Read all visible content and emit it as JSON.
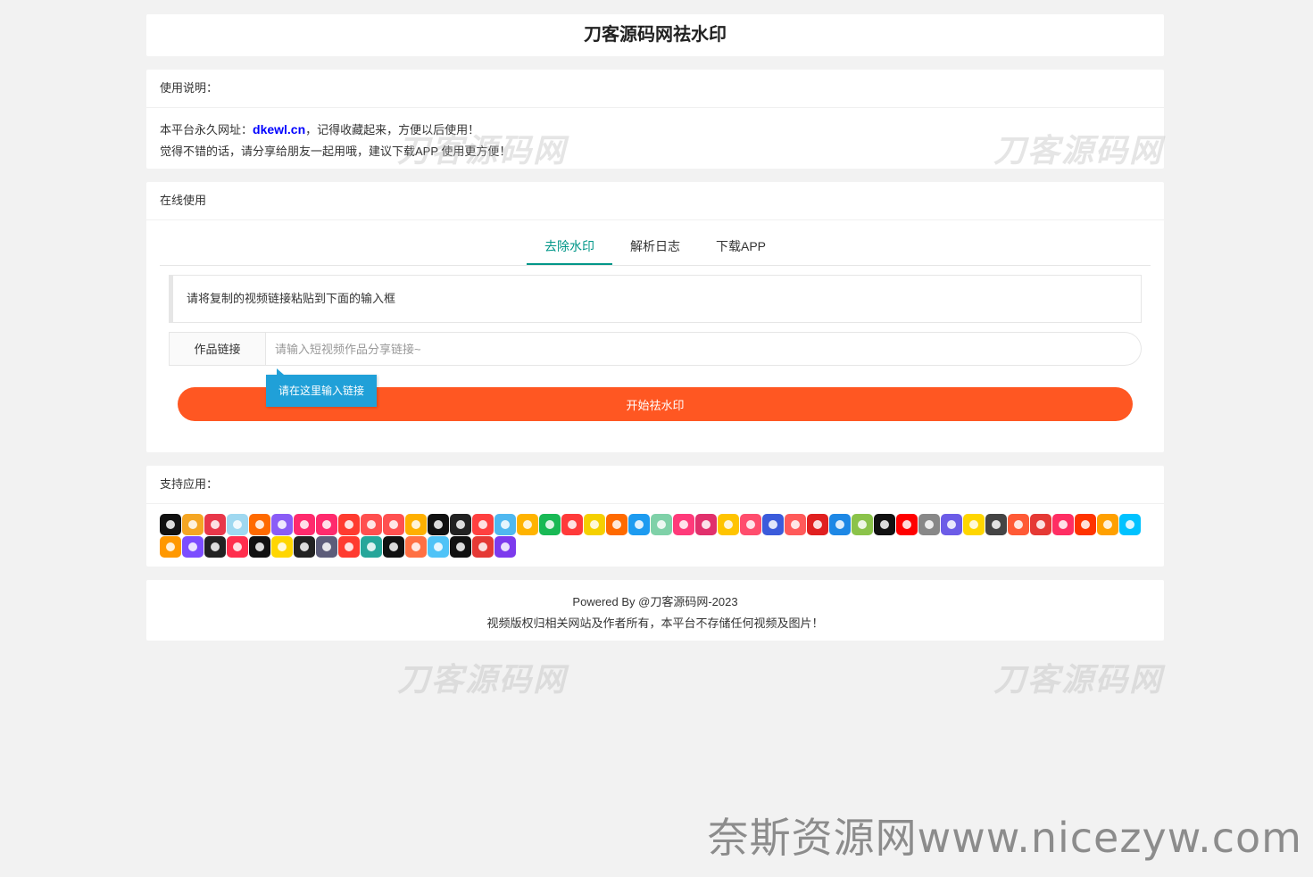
{
  "header": {
    "title": "刀客源码网祛水印"
  },
  "usage": {
    "heading": "使用说明：",
    "line1_prefix": "本平台永久网址：",
    "line1_link": "dkewl.cn",
    "line1_suffix": "，记得收藏起来，方便以后使用！",
    "line2": "觉得不错的话，请分享给朋友一起用哦，建议下载APP 使用更方便！"
  },
  "online": {
    "heading": "在线使用",
    "tabs": [
      {
        "label": "去除水印",
        "active": true
      },
      {
        "label": "解析日志",
        "active": false
      },
      {
        "label": "下载APP",
        "active": false
      }
    ],
    "notice": "请将复制的视频链接粘贴到下面的输入框",
    "input_label": "作品链接",
    "input_placeholder": "请输入短视频作品分享链接~",
    "input_value": "",
    "tooltip": "请在这里输入链接",
    "start_button": "开始祛水印"
  },
  "supported": {
    "heading": "支持应用：",
    "app_colors": [
      "#111111",
      "#f5a623",
      "#e8374a",
      "#9fd8f0",
      "#ff6a00",
      "#8a5cf6",
      "#ff2a6d",
      "#ff2a6d",
      "#ff3b30",
      "#ff4f4f",
      "#ff5050",
      "#ffb000",
      "#111111",
      "#222222",
      "#ff4040",
      "#4fb8f0",
      "#ffb300",
      "#19b955",
      "#ff3a3a",
      "#f5d000",
      "#ff6a00",
      "#1d9bf0",
      "#7fd1a8",
      "#ff3a7a",
      "#e1306c",
      "#ffc400",
      "#ff4d6d",
      "#3b5bdb",
      "#ff5a5a",
      "#e02020",
      "#1e88e5",
      "#8bc34a",
      "#111111",
      "#ff0000",
      "#888888",
      "#6c5ce7",
      "#ffd600",
      "#444444",
      "#ff5a36",
      "#e53935",
      "#ff2e63",
      "#ff3300",
      "#ffa000",
      "#00c2ff",
      "#ff9800",
      "#7c4dff",
      "#222222",
      "#ff2e4d",
      "#111111",
      "#ffd600",
      "#222222",
      "#5d5d7a",
      "#ff3b30",
      "#26a69a",
      "#111111",
      "#ff7043",
      "#4fc3f7",
      "#111111",
      "#e53935",
      "#7c3aed"
    ]
  },
  "footer": {
    "line1": "Powered By @刀客源码网-2023",
    "line2": "视频版权归相关网站及作者所有，本平台不存储任何视频及图片！"
  },
  "watermarks": {
    "text": "刀客源码网",
    "site": "奈斯资源网www.nicezyw.com"
  }
}
